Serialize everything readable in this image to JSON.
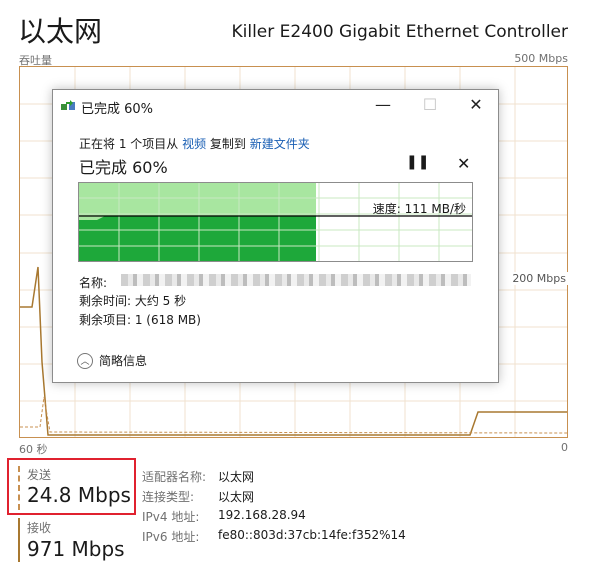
{
  "header": {
    "title": "以太网",
    "adapter_name": "Killer E2400 Gigabit Ethernet Controller",
    "throughput_label": "吞吐量",
    "max_scale": "500 Mbps",
    "mid_scale": "200 Mbps",
    "time_left": "60 秒",
    "time_right": "0"
  },
  "dialog": {
    "title": "已完成 60%",
    "line_prefix": "正在将 1 个项目从 ",
    "source": "视频",
    "line_middle": " 复制到 ",
    "destination": "新建文件夹",
    "percent_text": "已完成 60%",
    "progress": 0.6,
    "speed_text": "速度: 111 MB/秒",
    "name_label": "名称:",
    "remaining_time": "剩余时间: 大约 5 秒",
    "remaining_items": "剩余项目: 1 (618 MB)",
    "details_toggle": "简略信息",
    "pause_glyph": "❚❚",
    "close_glyph": "✕",
    "min_glyph": "—",
    "max_glyph": "☐"
  },
  "stats": {
    "send_label": "发送",
    "send_value": "24.8 Mbps",
    "receive_label": "接收",
    "receive_value": "971 Mbps",
    "properties": [
      {
        "key": "适配器名称:",
        "value": "以太网"
      },
      {
        "key": "连接类型:",
        "value": "以太网"
      },
      {
        "key": "IPv4 地址:",
        "value": "192.168.28.94"
      },
      {
        "key": "IPv6 地址:",
        "value": "fe80::803d:37cb:14fe:f352%14"
      }
    ]
  },
  "colors": {
    "accent": "#c89050",
    "progress_light": "#a8e6a0",
    "progress_dark": "#1ea83a",
    "highlight_box": "#e0212f",
    "link": "#1a5fb4"
  },
  "icons": {
    "copy": "copy-transfer-icon",
    "pause": "pause-icon",
    "close": "close-icon",
    "details": "chevron-up-icon"
  }
}
